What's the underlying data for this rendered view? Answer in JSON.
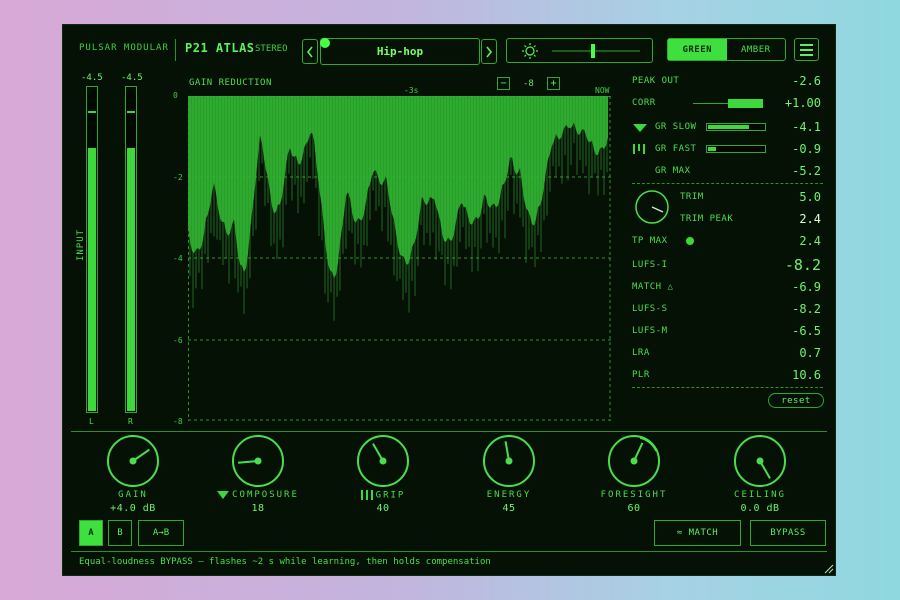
{
  "header": {
    "brand": "PULSAR MODULAR",
    "model": "P21 ATLAS",
    "mode": "STEREO",
    "preset": "Hip-hop",
    "prev_icon": "chevron-left-icon",
    "next_icon": "chevron-right-icon",
    "brightness_icon": "sun-icon",
    "color_options": [
      "GREEN",
      "AMBER"
    ],
    "color_selected": "GREEN",
    "menu_icon": "hamburger-menu-icon"
  },
  "input_meters": {
    "label": "INPUT",
    "left": {
      "label": "L",
      "peak": "-4.5",
      "level": 0.81
    },
    "right": {
      "label": "R",
      "peak": "-4.5",
      "level": 0.81
    }
  },
  "graph": {
    "title": "GAIN REDUCTION",
    "time_marker": "-3s",
    "now_label": "NOW",
    "zoom_minus": "−",
    "zoom_value": "-8",
    "zoom_plus": "+",
    "y_ticks": [
      "0",
      "-2",
      "-4",
      "-6",
      "-8"
    ]
  },
  "readouts": {
    "peak_out": {
      "label": "PEAK OUT",
      "value": "-2.6"
    },
    "corr": {
      "label": "CORR",
      "value": "+1.00",
      "level": 0.5
    },
    "gr_slow": {
      "label": "GR SLOW",
      "value": "-4.1",
      "level": 0.7
    },
    "gr_fast": {
      "label": "GR FAST",
      "value": "-0.9",
      "level": 0.13
    },
    "gr_max": {
      "label": "GR MAX",
      "value": "-5.2"
    },
    "trim": {
      "label": "TRIM",
      "value": "5.0"
    },
    "trim_peak": {
      "label": "TRIM PEAK",
      "value": "2.4"
    },
    "tp_max": {
      "label": "TP MAX",
      "value": "2.4"
    },
    "lufs_i": {
      "label": "LUFS-I",
      "value": "-8.2"
    },
    "match": {
      "label": "MATCH △",
      "value": "-6.9"
    },
    "lufs_s": {
      "label": "LUFS-S",
      "value": "-8.2"
    },
    "lufs_m": {
      "label": "LUFS-M",
      "value": "-6.5"
    },
    "lra": {
      "label": "LRA",
      "value": "0.7"
    },
    "plr": {
      "label": "PLR",
      "value": "10.6"
    },
    "reset": "reset"
  },
  "knobs": [
    {
      "label": "GAIN",
      "value": "+4.0 dB",
      "angle": 55
    },
    {
      "label": "COMPOSURE",
      "value": "18",
      "angle": -95
    },
    {
      "label": "GRIP",
      "value": "40",
      "angle": -30
    },
    {
      "label": "ENERGY",
      "value": "45",
      "angle": -10
    },
    {
      "label": "FORESIGHT",
      "value": "60",
      "angle": 25
    },
    {
      "label": "CEILING",
      "value": "0.0 dB",
      "angle": 150
    }
  ],
  "footer": {
    "ab": [
      "A",
      "B",
      "A→B"
    ],
    "ab_selected": "A",
    "match_button": "≈ MATCH",
    "bypass_button": "BYPASS",
    "status": "Equal-loudness BYPASS — flashes ~2 s while learning, then holds compensation"
  },
  "colors": {
    "accent": "#3ee03e",
    "background": "#061106",
    "text": "#4adf4a"
  }
}
